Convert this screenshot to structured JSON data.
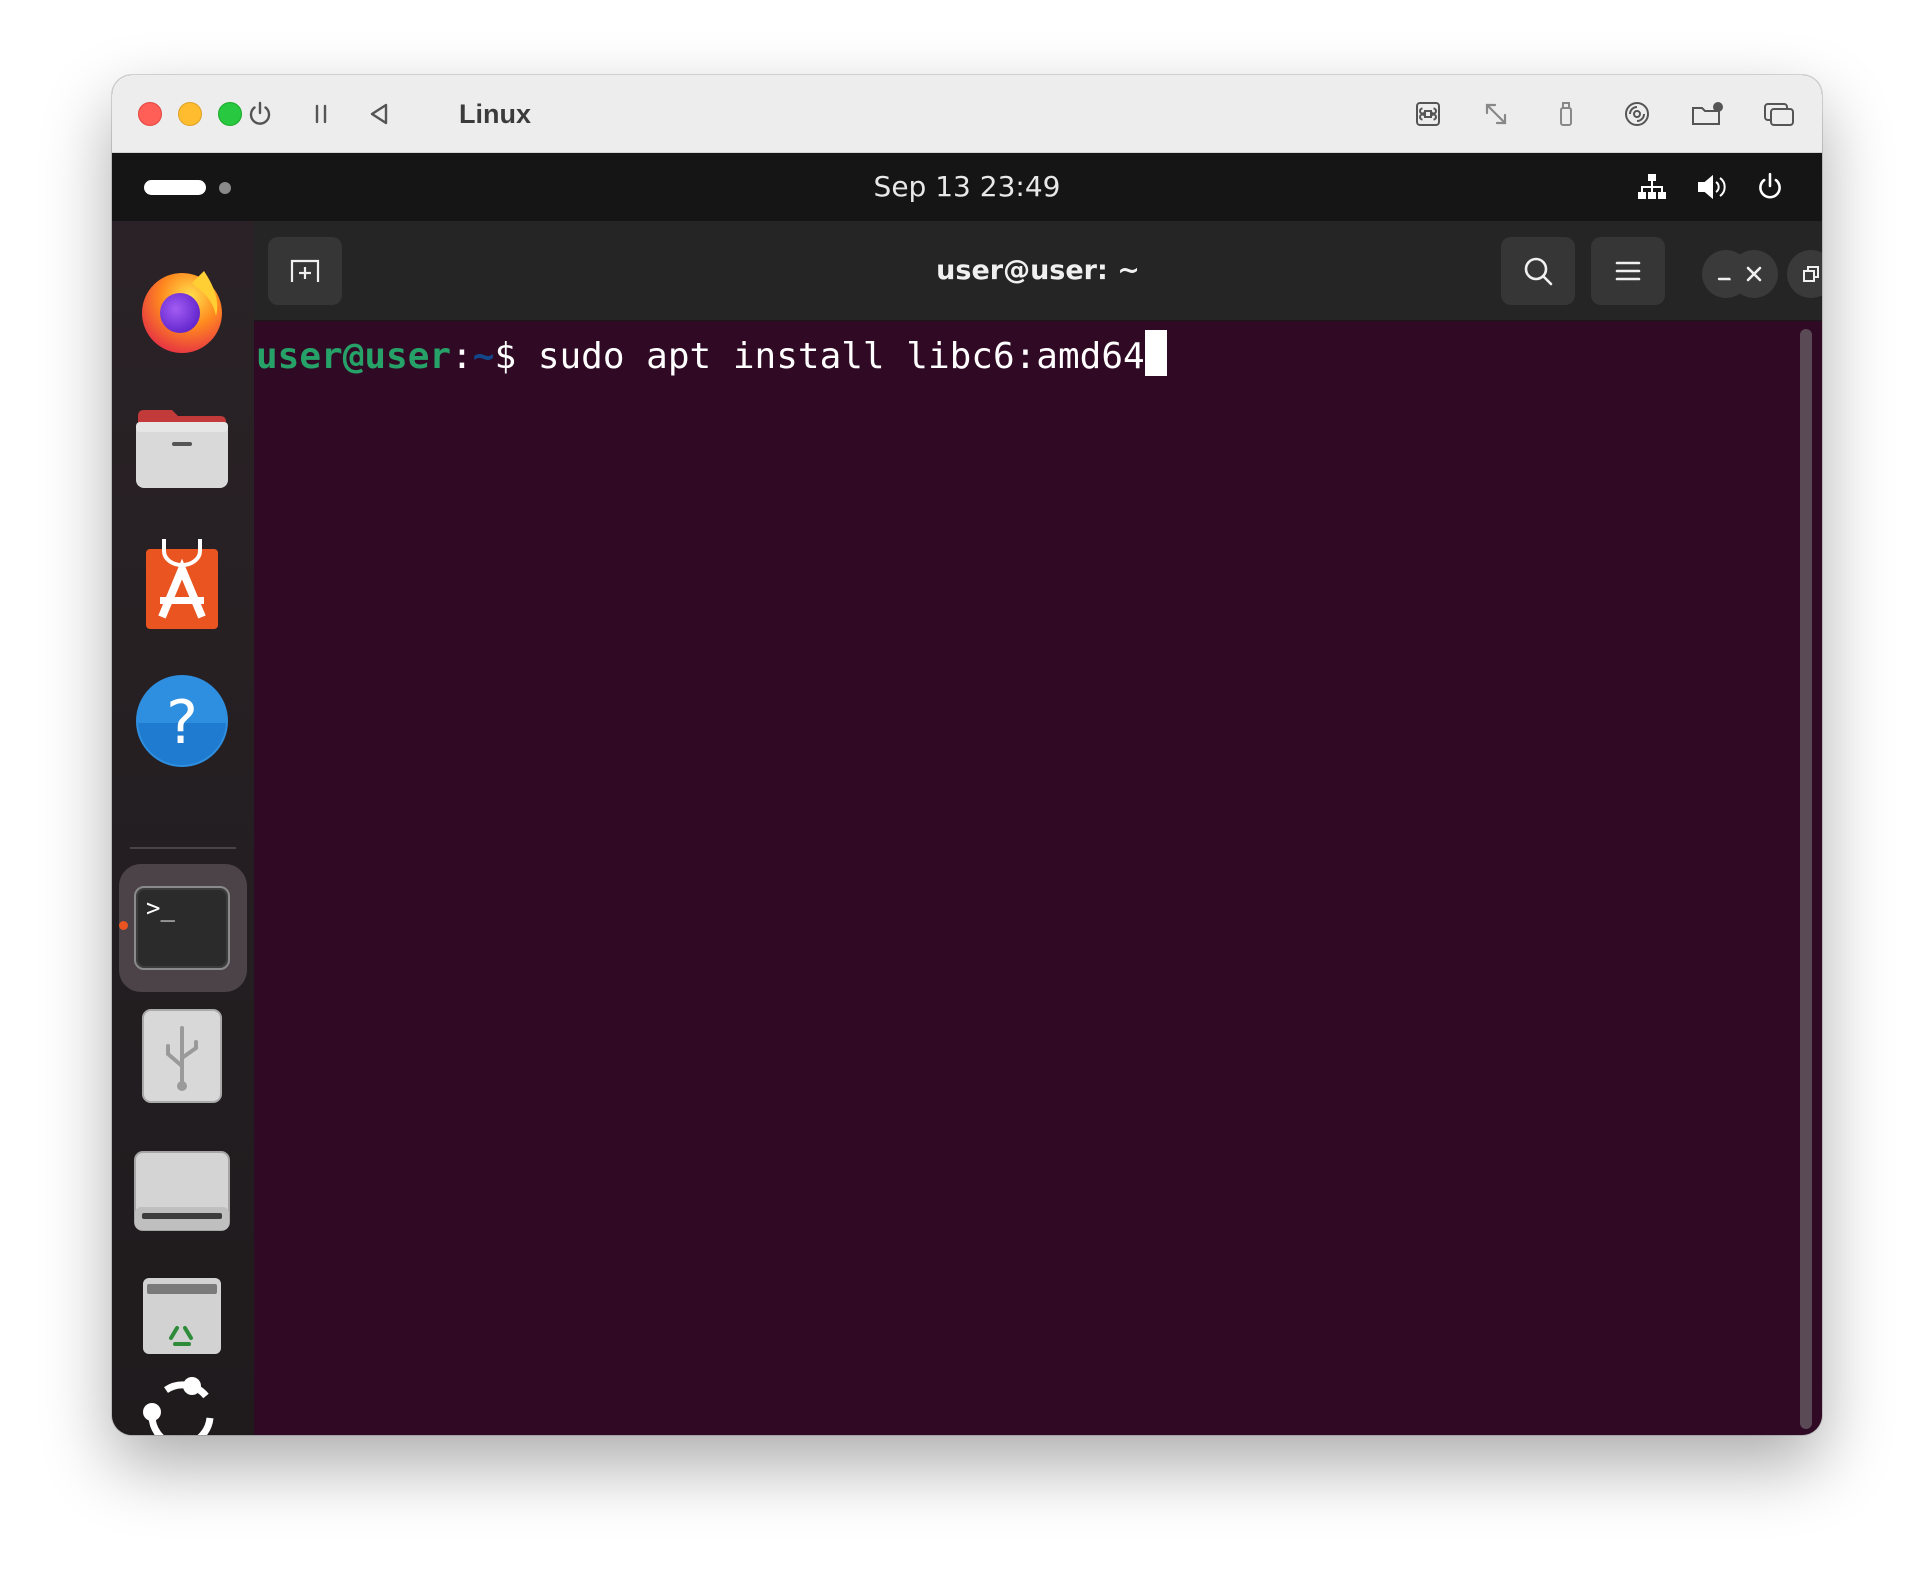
{
  "vm_window": {
    "title": "Linux",
    "controls": [
      {
        "name": "power-icon"
      },
      {
        "name": "pause-icon"
      },
      {
        "name": "back-icon"
      }
    ],
    "right_controls": [
      {
        "name": "keyboard-command-icon"
      },
      {
        "name": "resize-icon"
      },
      {
        "name": "usb-device-icon"
      },
      {
        "name": "disc-icon"
      },
      {
        "name": "shared-folder-icon"
      },
      {
        "name": "windows-icon"
      }
    ]
  },
  "topbar": {
    "clock": "Sep 13  23:49",
    "tray": [
      {
        "name": "network-icon"
      },
      {
        "name": "volume-icon"
      },
      {
        "name": "power-icon"
      }
    ]
  },
  "dock": {
    "items": [
      {
        "name": "firefox-icon"
      },
      {
        "name": "files-icon"
      },
      {
        "name": "app-center-icon"
      },
      {
        "name": "help-icon"
      },
      {
        "name": "terminal-icon",
        "active": true
      },
      {
        "name": "usb-drive-icon"
      },
      {
        "name": "disk-drive-icon"
      },
      {
        "name": "trash-icon"
      },
      {
        "name": "show-apps-icon"
      }
    ],
    "accent": "#e95420"
  },
  "terminal": {
    "title": "user@user: ~",
    "header_buttons": [
      {
        "name": "new-tab-icon"
      },
      {
        "name": "search-icon"
      },
      {
        "name": "menu-icon"
      },
      {
        "name": "minimize-icon"
      },
      {
        "name": "restore-icon"
      },
      {
        "name": "close-icon"
      }
    ],
    "prompt": {
      "user_host": "user@user",
      "colon": ":",
      "path": "~",
      "dollar": "$ ",
      "command": "sudo apt install libc6:amd64"
    },
    "colors": {
      "background": "#300a24",
      "prompt_user": "#26a269",
      "prompt_path": "#12488b"
    }
  }
}
